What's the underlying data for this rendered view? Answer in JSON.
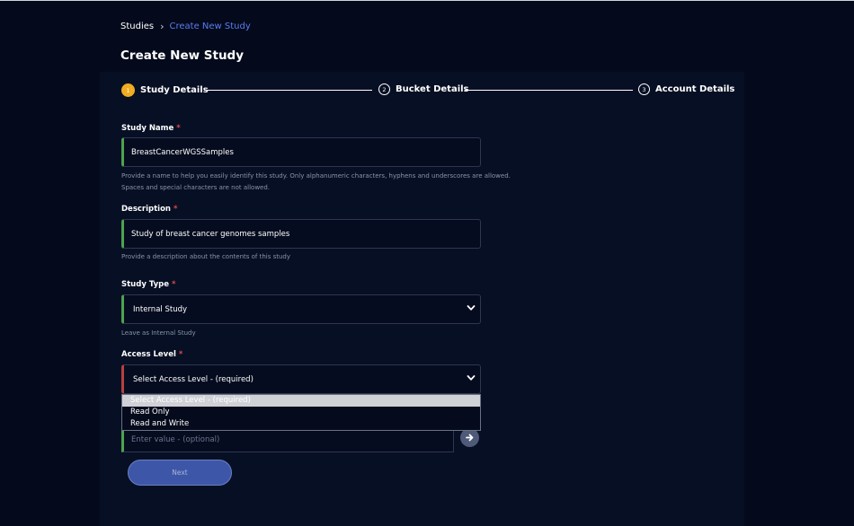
{
  "breadcrumb": {
    "root": "Studies",
    "separator": "›",
    "current": "Create New Study"
  },
  "page": {
    "title": "Create New Study"
  },
  "steps": [
    {
      "number": "1",
      "label": "Study Details",
      "state": "active"
    },
    {
      "number": "2",
      "label": "Bucket Details",
      "state": "pending"
    },
    {
      "number": "3",
      "label": "Account Details",
      "state": "pending"
    }
  ],
  "form": {
    "required_marker": "*",
    "study_name": {
      "label": "Study Name",
      "value": "BreastCancerWGSSamples",
      "help": "Provide a name to help you easily identify this study. Only alphanumeric characters, hyphens and underscores are allowed. Spaces and special characters are not allowed."
    },
    "description": {
      "label": "Description",
      "value": "Study of breast cancer genomes samples",
      "help": "Provide a description about the contents of this study"
    },
    "study_type": {
      "label": "Study Type",
      "value": "Internal Study",
      "help": "Leave as Internal Study"
    },
    "access_level": {
      "label": "Access Level",
      "value": "Select Access Level - (required)",
      "options": [
        "Select Access Level - (required)",
        "Read Only",
        "Read and Write"
      ]
    },
    "extra_value": {
      "placeholder": "Enter value - (optional)"
    },
    "next_label": "Next"
  },
  "colors": {
    "background": "#040a1c",
    "active_step": "#f0ad22",
    "valid_border": "#4ea24f",
    "invalid_border": "#b44040",
    "breadcrumb_link": "#5b7cf0",
    "next_button": "#3d56a8"
  },
  "icons": {
    "select_chevron": "chevron-down-icon",
    "add_button": "arrow-right-icon"
  }
}
